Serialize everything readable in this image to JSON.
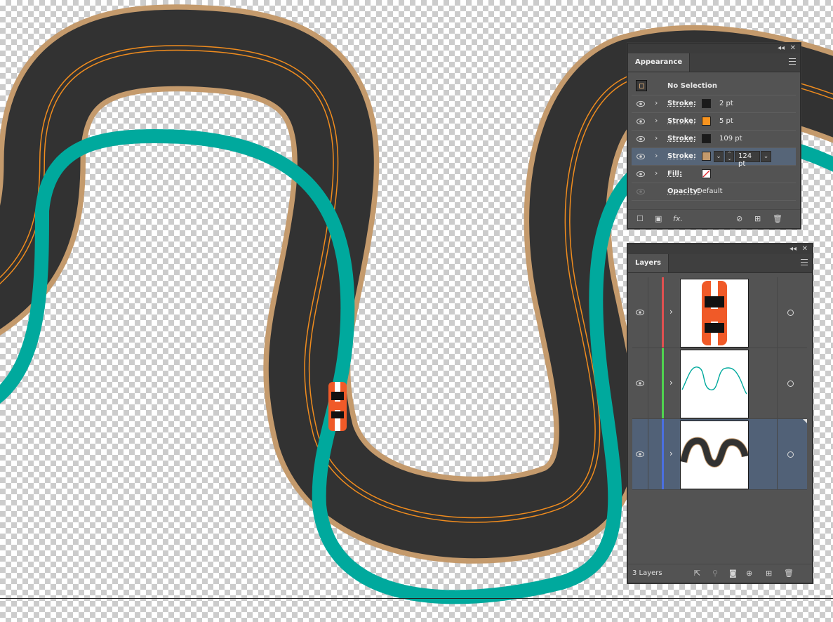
{
  "colors": {
    "track_border": "#c49a6c",
    "track_asphalt": "#323232",
    "track_lane_line": "#f08c1e",
    "path_teal": "#00a99d",
    "car_orange": "#f05a28",
    "layer_red": "#e05050",
    "layer_green": "#4fd34f",
    "layer_blue": "#4a6fe0"
  },
  "appearance_panel": {
    "title": "Appearance",
    "header_label": "No Selection",
    "rows": [
      {
        "label": "Stroke:",
        "value": "2 pt",
        "swatch": "#1a1a1a",
        "selected": false
      },
      {
        "label": "Stroke:",
        "value": "5 pt",
        "swatch": "#f7931e",
        "selected": false
      },
      {
        "label": "Stroke:",
        "value": "109 pt",
        "swatch": "#1a1a1a",
        "selected": false
      },
      {
        "label": "Stroke:",
        "value": "124 pt",
        "swatch": "#c49a6c",
        "selected": true
      },
      {
        "label": "Fill:",
        "value": "",
        "swatch": "none",
        "selected": false
      },
      {
        "label": "Opacity:",
        "value": "Default",
        "swatch": "",
        "selected": false
      }
    ],
    "footer_icons": [
      "new-stroke-icon",
      "new-fill-icon",
      "fx-icon",
      "clear-appearance-icon",
      "duplicate-item-icon",
      "delete-item-icon"
    ],
    "fx_label": "fx."
  },
  "layers_panel": {
    "title": "Layers",
    "count_label": "3 Layers",
    "layers": [
      {
        "thumb": "car",
        "color": "#e05050",
        "selected": false
      },
      {
        "thumb": "path",
        "color": "#4fd34f",
        "selected": false
      },
      {
        "thumb": "track",
        "color": "#4a6fe0",
        "selected": true
      }
    ]
  }
}
